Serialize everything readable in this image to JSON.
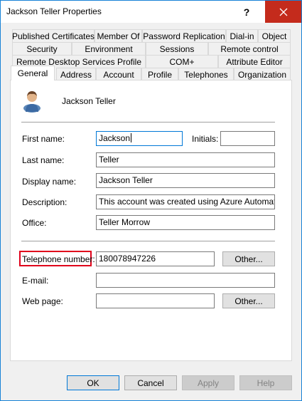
{
  "window": {
    "title": "Jackson Teller Properties"
  },
  "titlebar": {
    "help_label": "?",
    "close_glyph": "✕"
  },
  "tabs": {
    "row1": [
      "Published Certificates",
      "Member Of",
      "Password Replication",
      "Dial-in",
      "Object"
    ],
    "row2": [
      "Security",
      "Environment",
      "Sessions",
      "Remote control"
    ],
    "row3": [
      "Remote Desktop Services Profile",
      "COM+",
      "Attribute Editor"
    ],
    "row4": [
      "General",
      "Address",
      "Account",
      "Profile",
      "Telephones",
      "Organization"
    ],
    "active": "General"
  },
  "general": {
    "display_name_header": "Jackson Teller",
    "first_name_label": "First name:",
    "first_name_value": "Jackson",
    "initials_label": "Initials:",
    "initials_value": "",
    "last_name_label": "Last name:",
    "last_name_value": "Teller",
    "display_name_label": "Display name:",
    "display_name_value": "Jackson Teller",
    "description_label": "Description:",
    "description_value": "This account was created using Azure Automation in",
    "office_label": "Office:",
    "office_value": "Teller Morrow",
    "telephone_label": "Telephone number:",
    "telephone_value": "180078947226",
    "telephone_other_label": "Other...",
    "email_label": "E-mail:",
    "email_value": "",
    "webpage_label": "Web page:",
    "webpage_value": "",
    "webpage_other_label": "Other..."
  },
  "footer": {
    "ok_label": "OK",
    "cancel_label": "Cancel",
    "apply_label": "Apply",
    "help_label": "Help"
  },
  "colors": {
    "accent": "#0078d7",
    "close": "#c42b1c",
    "highlight": "#e0001b"
  }
}
